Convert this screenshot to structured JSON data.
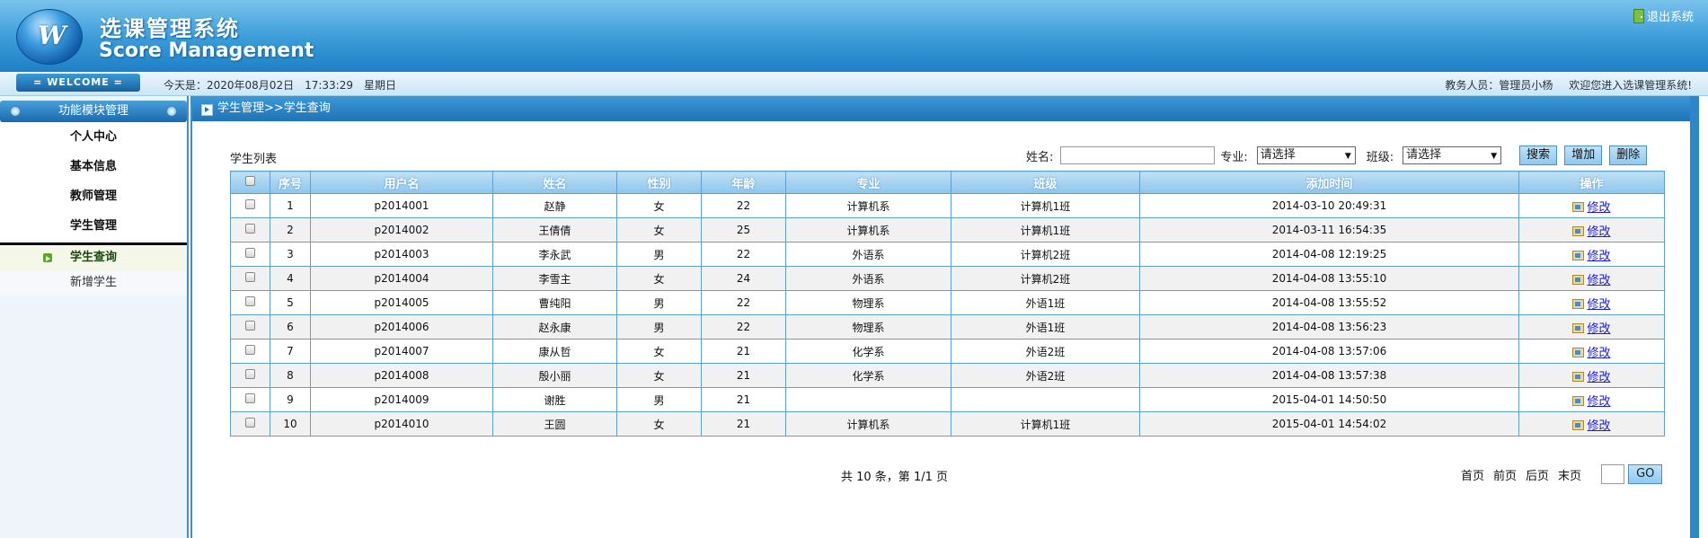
{
  "header": {
    "title_cn": "选课管理系统",
    "title_en": "Score Management",
    "logout": "退出系统"
  },
  "infobar": {
    "welcome": "= WELCOME =",
    "date_text": "今天是：2020年08月02日　17:33:29　星期日",
    "user_role": "教务人员：管理员小杨",
    "greeting": "欢迎您进入选课管理系统!"
  },
  "sidebar": {
    "heading": "功能模块管理",
    "items": [
      "个人中心",
      "基本信息",
      "教师管理",
      "学生管理"
    ],
    "sub_items": [
      "学生查询",
      "新增学生"
    ]
  },
  "breadcrumb": "学生管理>>学生查询",
  "list": {
    "label": "学生列表",
    "filter_name_label": "姓名:",
    "filter_major_label": "专业:",
    "filter_major_value": "请选择",
    "filter_class_label": "班级:",
    "filter_class_value": "请选择",
    "search": "搜索",
    "add": "增加",
    "delete": "删除"
  },
  "table": {
    "columns": [
      "序号",
      "用户名",
      "姓名",
      "性别",
      "年龄",
      "专业",
      "班级",
      "添加时间",
      "操作"
    ],
    "rows": [
      [
        "1",
        "p2014001",
        "赵静",
        "女",
        "22",
        "计算机系",
        "计算机1班",
        "2014-03-10 20:49:31"
      ],
      [
        "2",
        "p2014002",
        "王倩倩",
        "女",
        "25",
        "计算机系",
        "计算机1班",
        "2014-03-11 16:54:35"
      ],
      [
        "3",
        "p2014003",
        "李永武",
        "男",
        "22",
        "外语系",
        "计算机2班",
        "2014-04-08 12:19:25"
      ],
      [
        "4",
        "p2014004",
        "李雪主",
        "女",
        "24",
        "外语系",
        "计算机2班",
        "2014-04-08 13:55:10"
      ],
      [
        "5",
        "p2014005",
        "曹纯阳",
        "男",
        "22",
        "物理系",
        "外语1班",
        "2014-04-08 13:55:52"
      ],
      [
        "6",
        "p2014006",
        "赵永康",
        "男",
        "22",
        "物理系",
        "外语1班",
        "2014-04-08 13:56:23"
      ],
      [
        "7",
        "p2014007",
        "康从哲",
        "女",
        "21",
        "化学系",
        "外语2班",
        "2014-04-08 13:57:06"
      ],
      [
        "8",
        "p2014008",
        "殷小丽",
        "女",
        "21",
        "化学系",
        "外语2班",
        "2014-04-08 13:57:38"
      ],
      [
        "9",
        "p2014009",
        "谢胜",
        "男",
        "21",
        "",
        "",
        "2015-04-01 14:50:50"
      ],
      [
        "10",
        "p2014010",
        "王圆",
        "女",
        "21",
        "计算机系",
        "计算机1班",
        "2015-04-01 14:54:02"
      ]
    ],
    "edit_label": "修改"
  },
  "pager": {
    "info": "共 10 条，第 1/1 页",
    "first": "首页",
    "prev": "前页",
    "next": "后页",
    "last": "末页",
    "go": "GO"
  }
}
